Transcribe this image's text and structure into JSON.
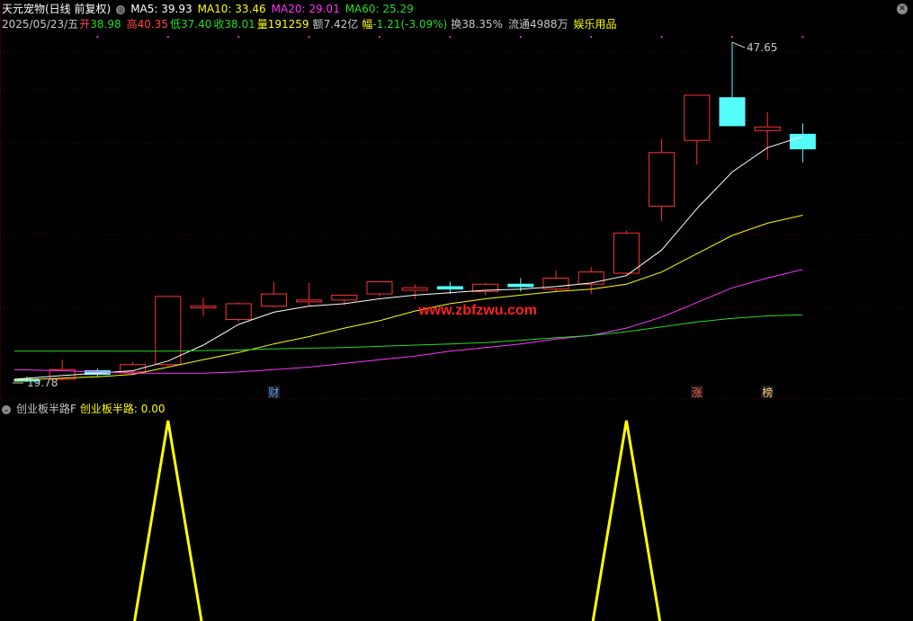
{
  "header": {
    "stock_name": "天元宠物(日线 前复权)",
    "ma": [
      {
        "label": "MA5: 39.93",
        "color": "#ffffff"
      },
      {
        "label": "MA10: 33.46",
        "color": "#ffff00"
      },
      {
        "label": "MA20: 29.01",
        "color": "#ff33ff"
      },
      {
        "label": "MA60: 25.29",
        "color": "#22dd22"
      }
    ],
    "date": "2025/05/23/五",
    "open_label": "开",
    "open": "38.98",
    "high_label": "高",
    "high": "40.35",
    "low_label": "低",
    "low": "37.40",
    "close_label": "收",
    "close": "38.01",
    "volume_label": "量",
    "volume": "191259",
    "amount_label": "额",
    "amount": "7.42亿",
    "change_label": "幅",
    "change": "-1.21(-3.09%)",
    "turnover": "换38.35%",
    "float": "流通4988万",
    "sector": "娱乐用品"
  },
  "indicator": {
    "name": "创业板半路F",
    "value_label": "创业板半路: 0.00"
  },
  "watermark": "www.zbfzwu.com",
  "markers": [
    {
      "text": "财",
      "bar": 7,
      "color": "#6699ff"
    },
    {
      "text": "涨",
      "bar": 19,
      "color": "#ff5555"
    },
    {
      "text": "榜",
      "bar": 21,
      "color": "#ffcc88"
    }
  ],
  "colors": {
    "up": "#ff3232",
    "down": "#54fcfc",
    "indicator": "#ffff00"
  },
  "chart_data": {
    "type": "candlestick",
    "price_range": [
      16.5,
      50
    ],
    "annotations": [
      {
        "text": "47.65",
        "price": 47.65,
        "bar": 20
      },
      {
        "text": "19.78",
        "price": 19.78,
        "bar": 0
      }
    ],
    "candles": [
      {
        "o": 20.0,
        "h": 20.2,
        "l": 19.78,
        "c": 19.85
      },
      {
        "o": 20.0,
        "h": 21.6,
        "l": 19.9,
        "c": 20.8
      },
      {
        "o": 20.7,
        "h": 20.9,
        "l": 20.2,
        "c": 20.4
      },
      {
        "o": 20.6,
        "h": 21.4,
        "l": 20.5,
        "c": 21.2
      },
      {
        "o": 21.2,
        "h": 26.8,
        "l": 21.1,
        "c": 26.8
      },
      {
        "o": 26.0,
        "h": 26.7,
        "l": 25.2,
        "c": 26.0
      },
      {
        "o": 24.9,
        "h": 26.3,
        "l": 24.7,
        "c": 26.2
      },
      {
        "o": 26.0,
        "h": 28.0,
        "l": 25.9,
        "c": 27.0
      },
      {
        "o": 26.5,
        "h": 27.9,
        "l": 26.0,
        "c": 26.5
      },
      {
        "o": 26.5,
        "h": 26.9,
        "l": 26.1,
        "c": 26.9
      },
      {
        "o": 27.0,
        "h": 28.0,
        "l": 26.8,
        "c": 28.0
      },
      {
        "o": 27.3,
        "h": 27.8,
        "l": 26.6,
        "c": 27.5
      },
      {
        "o": 27.6,
        "h": 28.0,
        "l": 27.0,
        "c": 27.4
      },
      {
        "o": 27.2,
        "h": 27.9,
        "l": 26.9,
        "c": 27.8
      },
      {
        "o": 27.8,
        "h": 28.3,
        "l": 27.2,
        "c": 27.6
      },
      {
        "o": 27.4,
        "h": 28.9,
        "l": 27.2,
        "c": 28.3
      },
      {
        "o": 27.8,
        "h": 29.2,
        "l": 27.0,
        "c": 28.8
      },
      {
        "o": 28.7,
        "h": 32.2,
        "l": 28.6,
        "c": 32.0
      },
      {
        "o": 34.2,
        "h": 39.7,
        "l": 33.0,
        "c": 38.6
      },
      {
        "o": 39.6,
        "h": 43.3,
        "l": 37.6,
        "c": 43.3
      },
      {
        "o": 43.1,
        "h": 47.65,
        "l": 41.0,
        "c": 40.8
      },
      {
        "o": 40.4,
        "h": 41.9,
        "l": 38.0,
        "c": 40.7
      },
      {
        "o": 40.1,
        "h": 41.0,
        "l": 37.8,
        "c": 38.9
      }
    ],
    "ma_lines": [
      {
        "name": "MA5",
        "color": "#ffffff",
        "start_bar": 0,
        "values": [
          20.0,
          20.3,
          20.5,
          20.7,
          21.5,
          22.8,
          24.5,
          25.5,
          26.0,
          26.2,
          26.6,
          26.9,
          27.1,
          27.3,
          27.4,
          27.6,
          27.9,
          28.5,
          30.6,
          34.0,
          37.0,
          39.0,
          39.93
        ]
      },
      {
        "name": "MA10",
        "color": "#ffff00",
        "start_bar": 0,
        "values": [
          19.9,
          20.1,
          20.2,
          20.4,
          21.0,
          21.6,
          22.2,
          22.9,
          23.5,
          24.2,
          24.8,
          25.6,
          26.2,
          26.6,
          26.9,
          27.2,
          27.4,
          27.8,
          28.8,
          30.3,
          31.8,
          32.8,
          33.46
        ]
      },
      {
        "name": "MA20",
        "color": "#ff33ff",
        "start_bar": 0,
        "values": [
          20.8,
          20.7,
          20.6,
          20.5,
          20.5,
          20.5,
          20.6,
          20.8,
          21.0,
          21.3,
          21.6,
          21.9,
          22.3,
          22.6,
          22.9,
          23.3,
          23.6,
          24.2,
          25.1,
          26.3,
          27.5,
          28.3,
          29.01
        ]
      },
      {
        "name": "MA60",
        "color": "#22dd22",
        "start_bar": 0,
        "values": [
          22.3,
          22.3,
          22.3,
          22.3,
          22.3,
          22.35,
          22.4,
          22.5,
          22.55,
          22.6,
          22.7,
          22.8,
          22.9,
          23.0,
          23.2,
          23.4,
          23.6,
          23.9,
          24.3,
          24.7,
          25.0,
          25.2,
          25.29
        ]
      }
    ],
    "indicator_series": {
      "name": "创业板半路",
      "peaks_at_bars": [
        4,
        17
      ],
      "value": 0.0
    }
  }
}
